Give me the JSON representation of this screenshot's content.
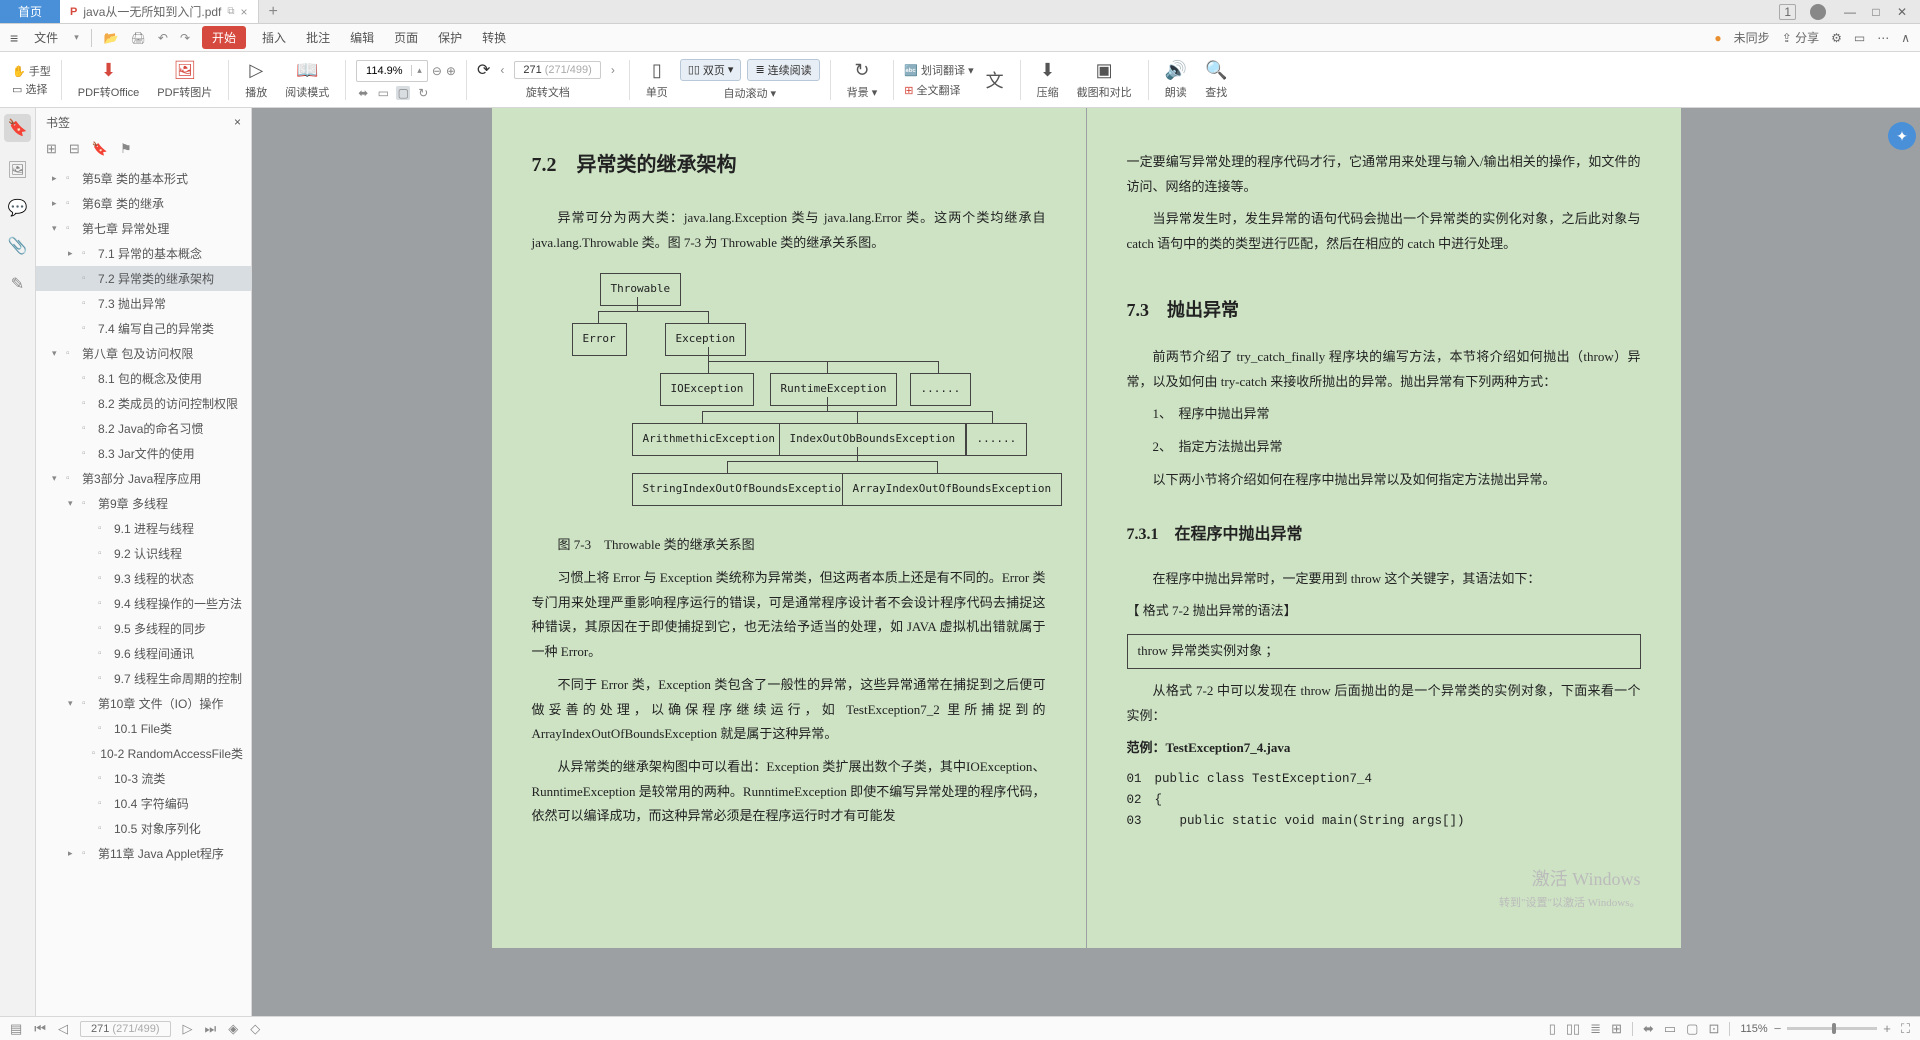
{
  "titlebar": {
    "home": "首页",
    "filename": "java从一无所知到入门.pdf",
    "badge": "1"
  },
  "menubar": {
    "file": "文件",
    "items": [
      "开始",
      "插入",
      "批注",
      "编辑",
      "页面",
      "保护",
      "转换"
    ],
    "sync": "未同步",
    "share": "分享"
  },
  "toolbar": {
    "hand": "手型",
    "select": "选择",
    "pdf2office": "PDF转Office",
    "pdf2img": "PDF转图片",
    "play": "播放",
    "readmode": "阅读模式",
    "zoom": "114.9%",
    "page_current": "271",
    "page_total": "(271/499)",
    "rotate": "旋转文档",
    "single": "单页",
    "double": "双页",
    "continuous": "连续阅读",
    "autoscroll": "自动滚动",
    "background": "背景",
    "dict": "划词翻译",
    "fulltrans": "全文翻译",
    "compress": "压缩",
    "compare": "截图和对比",
    "read": "朗读",
    "find": "查找"
  },
  "sidebar": {
    "title": "书签",
    "items": [
      {
        "level": 1,
        "toggle": "▸",
        "text": "第5章  类的基本形式"
      },
      {
        "level": 1,
        "toggle": "▸",
        "text": "第6章  类的继承"
      },
      {
        "level": 1,
        "toggle": "▾",
        "text": "第七章  异常处理"
      },
      {
        "level": 2,
        "toggle": "▸",
        "text": "7.1  异常的基本概念"
      },
      {
        "level": 2,
        "toggle": "",
        "text": "7.2  异常类的继承架构",
        "selected": true
      },
      {
        "level": 2,
        "toggle": "",
        "text": "7.3  抛出异常"
      },
      {
        "level": 2,
        "toggle": "",
        "text": "7.4  编写自己的异常类"
      },
      {
        "level": 1,
        "toggle": "▾",
        "text": "第八章  包及访问权限"
      },
      {
        "level": 2,
        "toggle": "",
        "text": "8.1  包的概念及使用"
      },
      {
        "level": 2,
        "toggle": "",
        "text": "8.2  类成员的访问控制权限"
      },
      {
        "level": 2,
        "toggle": "",
        "text": "8.2  Java的命名习惯"
      },
      {
        "level": 2,
        "toggle": "",
        "text": "8.3  Jar文件的使用"
      },
      {
        "level": 1,
        "toggle": "▾",
        "text": "第3部分   Java程序应用"
      },
      {
        "level": 2,
        "toggle": "▾",
        "text": "第9章  多线程"
      },
      {
        "level": 3,
        "toggle": "",
        "text": "9.1  进程与线程"
      },
      {
        "level": 3,
        "toggle": "",
        "text": "9.2  认识线程"
      },
      {
        "level": 3,
        "toggle": "",
        "text": "9.3  线程的状态"
      },
      {
        "level": 3,
        "toggle": "",
        "text": "9.4  线程操作的一些方法"
      },
      {
        "level": 3,
        "toggle": "",
        "text": "9.5  多线程的同步"
      },
      {
        "level": 3,
        "toggle": "",
        "text": "9.6  线程间通讯"
      },
      {
        "level": 3,
        "toggle": "",
        "text": "9.7  线程生命周期的控制"
      },
      {
        "level": 2,
        "toggle": "▾",
        "text": "第10章 文件（IO）操作"
      },
      {
        "level": 3,
        "toggle": "",
        "text": "10.1  File类"
      },
      {
        "level": 3,
        "toggle": "",
        "text": "10-2  RandomAccessFile类"
      },
      {
        "level": 3,
        "toggle": "",
        "text": "10-3  流类"
      },
      {
        "level": 3,
        "toggle": "",
        "text": "10.4  字符编码"
      },
      {
        "level": 3,
        "toggle": "",
        "text": "10.5  对象序列化"
      },
      {
        "level": 2,
        "toggle": "▸",
        "text": "第11章 Java Applet程序"
      }
    ]
  },
  "doc": {
    "left": {
      "h72": "7.2　异常类的继承架构",
      "p72a": "异常可分为两大类：java.lang.Exception 类与 java.lang.Error 类。这两个类均继承自 java.lang.Throwable 类。图 7-3 为 Throwable 类的继承关系图。",
      "boxes": {
        "throwable": "Throwable",
        "error": "Error",
        "exception": "Exception",
        "io": "IOException",
        "runtime": "RuntimeException",
        "d1": "......",
        "arith": "ArithmethicException",
        "iob": "IndexOutObBoundsException",
        "d2": "......",
        "sioob": "StringIndexOutOfBoundsException",
        "aioob": "ArrayIndexOutOfBoundsException"
      },
      "caption": "图 7-3　Throwable 类的继承关系图",
      "p72b": "习惯上将 Error 与 Exception 类统称为异常类，但这两者本质上还是有不同的。Error 类专门用来处理严重影响程序运行的错误，可是通常程序设计者不会设计程序代码去捕捉这种错误，其原因在于即使捕捉到它，也无法给予适当的处理，如 JAVA 虚拟机出错就属于一种 Error。",
      "p72c": "不同于 Error 类，Exception 类包含了一般性的异常，这些异常通常在捕捉到之后便可做妥善的处理，以确保程序继续运行，如 TestException7_2 里所捕捉到的ArrayIndexOutOfBoundsException 就是属于这种异常。",
      "p72d": "从异常类的继承架构图中可以看出：Exception 类扩展出数个子类，其中IOException、RunntimeException 是较常用的两种。RunntimeException 即使不编写异常处理的程序代码，依然可以编译成功，而这种异常必须是在程序运行时才有可能发"
    },
    "right": {
      "p_cont1": "一定要编写异常处理的程序代码才行，它通常用来处理与输入/输出相关的操作，如文件的访问、网络的连接等。",
      "p_cont2": "当异常发生时，发生异常的语句代码会抛出一个异常类的实例化对象，之后此对象与 catch 语句中的类的类型进行匹配，然后在相应的 catch 中进行处理。",
      "h73": "7.3　抛出异常",
      "p73a": "前两节介绍了 try_catch_finally 程序块的编写方法，本节将介绍如何抛出（throw）异常，以及如何由 try-catch 来接收所抛出的异常。抛出异常有下列两种方式：",
      "li1": "1、　程序中抛出异常",
      "li2": "2、　指定方法抛出异常",
      "p73b": "以下两小节将介绍如何在程序中抛出异常以及如何指定方法抛出异常。",
      "h731": "7.3.1　在程序中抛出异常",
      "p731a": "在程序中抛出异常时，一定要用到 throw 这个关键字，其语法如下：",
      "fmt_label": "【 格式 7-2  抛出异常的语法】",
      "fmt_code": "throw  异常类实例对象 ；",
      "p731b": "从格式 7-2 中可以发现在 throw 后面抛出的是一个异常类的实例对象，下面来看一个实例：",
      "ex_label": "范例：TestException7_4.java",
      "code": [
        {
          "n": "01",
          "t": "public class TestException7_4"
        },
        {
          "n": "02",
          "t": "{"
        },
        {
          "n": "03",
          "t": "　　public static void main(String args[])"
        }
      ]
    },
    "watermark": "激活 Windows",
    "watermark_sub": "转到\"设置\"以激活 Windows。"
  },
  "statusbar": {
    "page_cur": "271",
    "page_tot": "(271/499)",
    "zoom": "115%"
  }
}
